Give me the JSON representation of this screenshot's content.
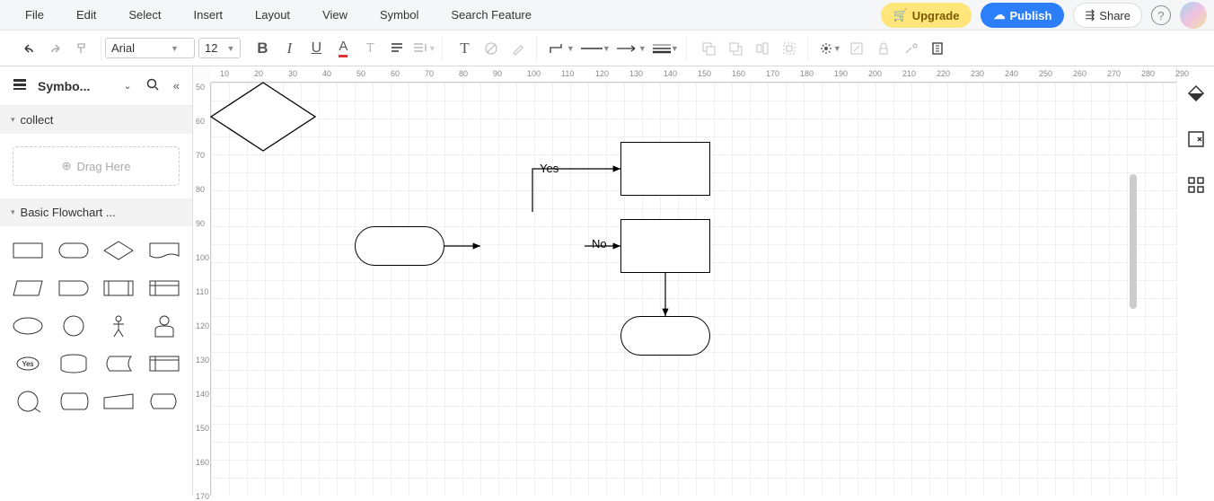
{
  "menu": {
    "file": "File",
    "edit": "Edit",
    "select": "Select",
    "insert": "Insert",
    "layout": "Layout",
    "view": "View",
    "symbol": "Symbol",
    "search": "Search Feature"
  },
  "top_right": {
    "upgrade": "Upgrade",
    "publish": "Publish",
    "share": "Share"
  },
  "toolbar": {
    "font": "Arial",
    "size": "12"
  },
  "sidebar": {
    "title": "Symbo...",
    "collect": "collect",
    "drag": "Drag Here",
    "basic": "Basic Flowchart ..."
  },
  "ruler_h": [
    "10",
    "20",
    "30",
    "40",
    "50",
    "60",
    "70",
    "80",
    "90",
    "100",
    "110",
    "120",
    "130",
    "140",
    "150",
    "160",
    "170",
    "180",
    "190",
    "200",
    "210",
    "220",
    "230",
    "240",
    "250",
    "260",
    "270",
    "280",
    "290"
  ],
  "ruler_v": [
    "50",
    "60",
    "70",
    "80",
    "90",
    "100",
    "110",
    "120",
    "130",
    "140",
    "150",
    "160",
    "170"
  ],
  "flow": {
    "yes": "Yes",
    "no": "No"
  },
  "shape_yes": "Yes"
}
